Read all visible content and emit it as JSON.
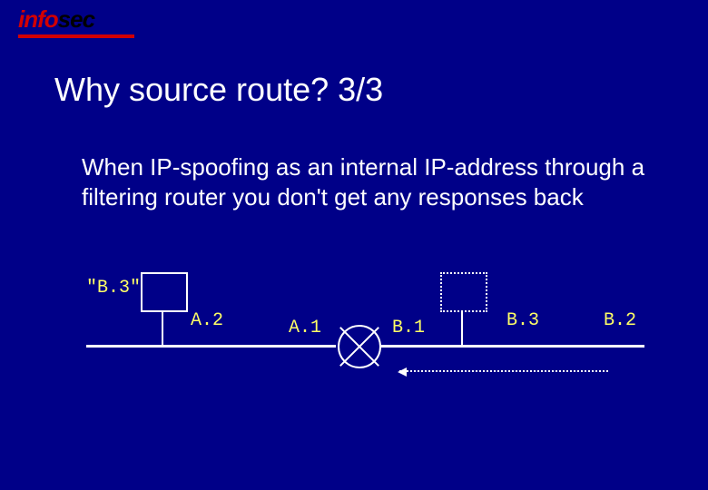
{
  "logo": {
    "left": "info",
    "right": "sec"
  },
  "title": "Why source route? 3/3",
  "body_text": "When IP-spoofing as an internal IP-address through a filtering router you don't get any responses back",
  "labels": {
    "spoofed": "\"B.3\"",
    "a2": "A.2",
    "a1": "A.1",
    "b1": "B.1",
    "b3": "B.3",
    "b2": "B.2"
  },
  "colors": {
    "background": "#000088",
    "label": "#ffff66",
    "logo_red": "#d20000"
  }
}
